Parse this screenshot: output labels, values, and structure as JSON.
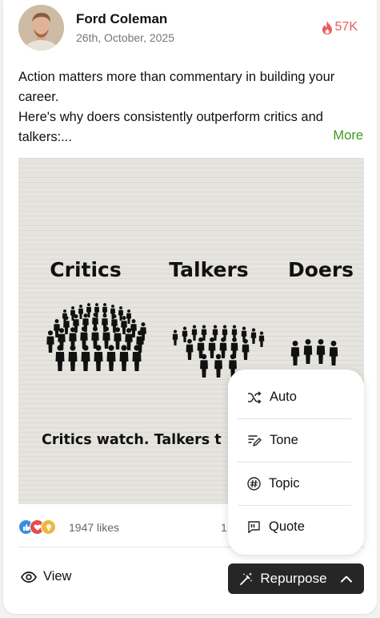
{
  "author": {
    "name": "Ford Coleman",
    "date": "26th, October, 2025"
  },
  "hot": {
    "icon": "flame-icon",
    "count": "57K",
    "color": "#ef5a5a"
  },
  "post": {
    "line1": "Action matters more than commentary in building your career.",
    "line2": "Here's why doers consistently outperform critics and talkers:...",
    "more_label": "More"
  },
  "image": {
    "heading_critics": "Critics",
    "heading_talkers": "Talkers",
    "heading_doers": "Doers",
    "caption": "Critics watch. Talkers t"
  },
  "stats": {
    "likes": "1947 likes",
    "comments_partial": "1"
  },
  "actions": {
    "view_label": "View",
    "repurpose_label": "Repurpose"
  },
  "menu": {
    "items": [
      {
        "label": "Auto",
        "icon": "shuffle-icon"
      },
      {
        "label": "Tone",
        "icon": "tone-icon"
      },
      {
        "label": "Topic",
        "icon": "hashtag-icon"
      },
      {
        "label": "Quote",
        "icon": "quote-icon"
      }
    ]
  },
  "colors": {
    "accent_green": "#3e9b1d",
    "button_dark": "#262626"
  }
}
